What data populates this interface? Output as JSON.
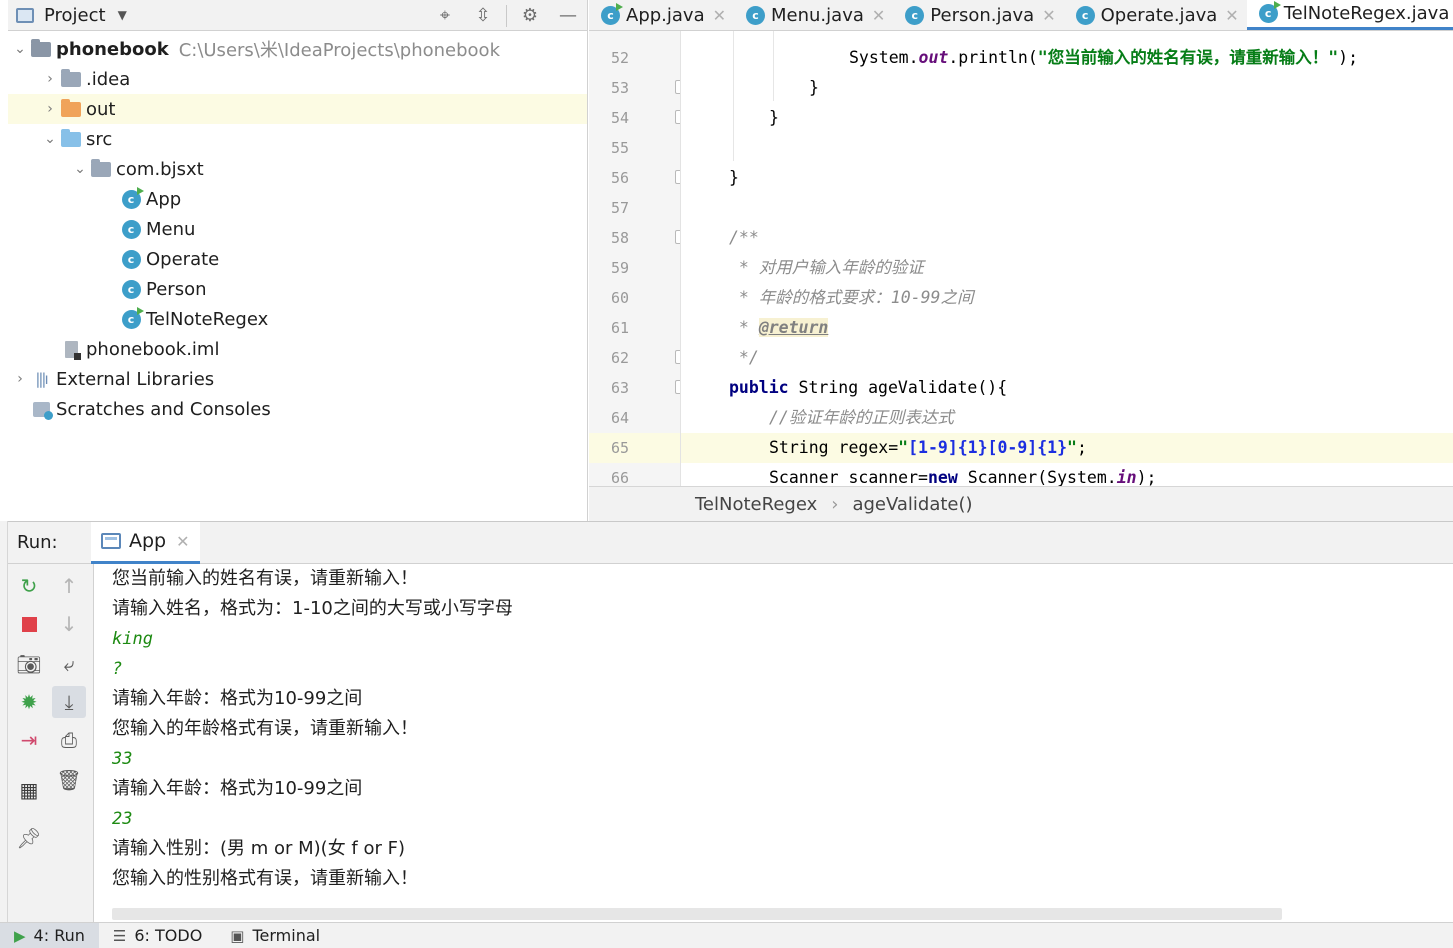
{
  "project_panel": {
    "title": "Project",
    "tree": [
      {
        "label": "phonebook",
        "hint": "C:\\Users\\米\\IdeaProjects\\phonebook",
        "icon": "module-folder-icon"
      },
      {
        "label": ".idea",
        "icon": "folder-icon"
      },
      {
        "label": "out",
        "icon": "excluded-folder-icon"
      },
      {
        "label": "src",
        "icon": "source-folder-icon"
      },
      {
        "label": "com.bjsxt",
        "icon": "package-icon"
      },
      {
        "label": "App",
        "icon": "runnable-class-icon"
      },
      {
        "label": "Menu",
        "icon": "class-icon"
      },
      {
        "label": "Operate",
        "icon": "class-icon"
      },
      {
        "label": "Person",
        "icon": "class-icon"
      },
      {
        "label": "TelNoteRegex",
        "icon": "runnable-class-icon"
      },
      {
        "label": "phonebook.iml",
        "icon": "iml-file-icon"
      },
      {
        "label": "External Libraries",
        "icon": "libraries-icon"
      },
      {
        "label": "Scratches and Consoles",
        "icon": "scratches-icon"
      }
    ]
  },
  "editor": {
    "tabs": [
      {
        "label": "App.java"
      },
      {
        "label": "Menu.java"
      },
      {
        "label": "Person.java"
      },
      {
        "label": "Operate.java"
      },
      {
        "label": "TelNoteRegex.java"
      }
    ],
    "line_numbers": [
      "52",
      "53",
      "54",
      "55",
      "56",
      "57",
      "58",
      "59",
      "60",
      "61",
      "62",
      "63",
      "64",
      "65",
      "66"
    ],
    "code": {
      "l52_a": "System.",
      "l52_b": "out",
      "l52_c": ".println(",
      "l52_d": "\"您当前输入的姓名有误，请重新输入！\"",
      "l52_e": ");",
      "l53": "}",
      "l54": "}",
      "l56": "}",
      "l58": "/**",
      "l59": " * 对用户输入年龄的验证",
      "l60": " * 年龄的格式要求：10-99之间",
      "l61_a": " * ",
      "l61_b": "@return",
      "l62": " */",
      "l63_a": "public",
      "l63_b": " String ageValidate(){",
      "l64": "//验证年龄的正则表达式",
      "l65_a": "String regex=",
      "l65_b": "\"",
      "l65_c": "[1-9]{1}[0-9]{1}",
      "l65_d": "\"",
      "l65_e": ";",
      "l66_a": "Scanner scanner=",
      "l66_b": "new",
      "l66_c": " Scanner(System.",
      "l66_d": "in",
      "l66_e": ");"
    },
    "breadcrumbs": [
      "TelNoteRegex",
      "ageValidate()"
    ]
  },
  "run_panel": {
    "label": "Run:",
    "tab": "App",
    "console": [
      {
        "type": "out",
        "text": "您当前输入的姓名有误，请重新输入！"
      },
      {
        "type": "out",
        "text": "请输入姓名，格式为：1-10之间的大写或小写字母"
      },
      {
        "type": "in",
        "text": "king"
      },
      {
        "type": "in",
        "text": "?"
      },
      {
        "type": "out",
        "text": "请输入年龄：格式为10-99之间"
      },
      {
        "type": "out",
        "text": "您输入的年龄格式有误，请重新输入！"
      },
      {
        "type": "in",
        "text": "33"
      },
      {
        "type": "out",
        "text": "请输入年龄：格式为10-99之间"
      },
      {
        "type": "in",
        "text": "23"
      },
      {
        "type": "out",
        "text": "请输入性别：(男 m or M)(女 f or F)"
      },
      {
        "type": "out",
        "text": "您输入的性别格式有误，请重新输入！"
      }
    ]
  },
  "bottom_bar": {
    "tabs": [
      {
        "label": "4: Run",
        "icon": "run-icon"
      },
      {
        "label": "6: TODO",
        "icon": "todo-icon"
      },
      {
        "label": "Terminal",
        "icon": "terminal-icon"
      }
    ]
  },
  "colors": {
    "accent": "#4083c9",
    "current_line": "#fcfbe3",
    "string": "#067d17",
    "keyword": "#000080",
    "console_input": "#1d8a12"
  }
}
